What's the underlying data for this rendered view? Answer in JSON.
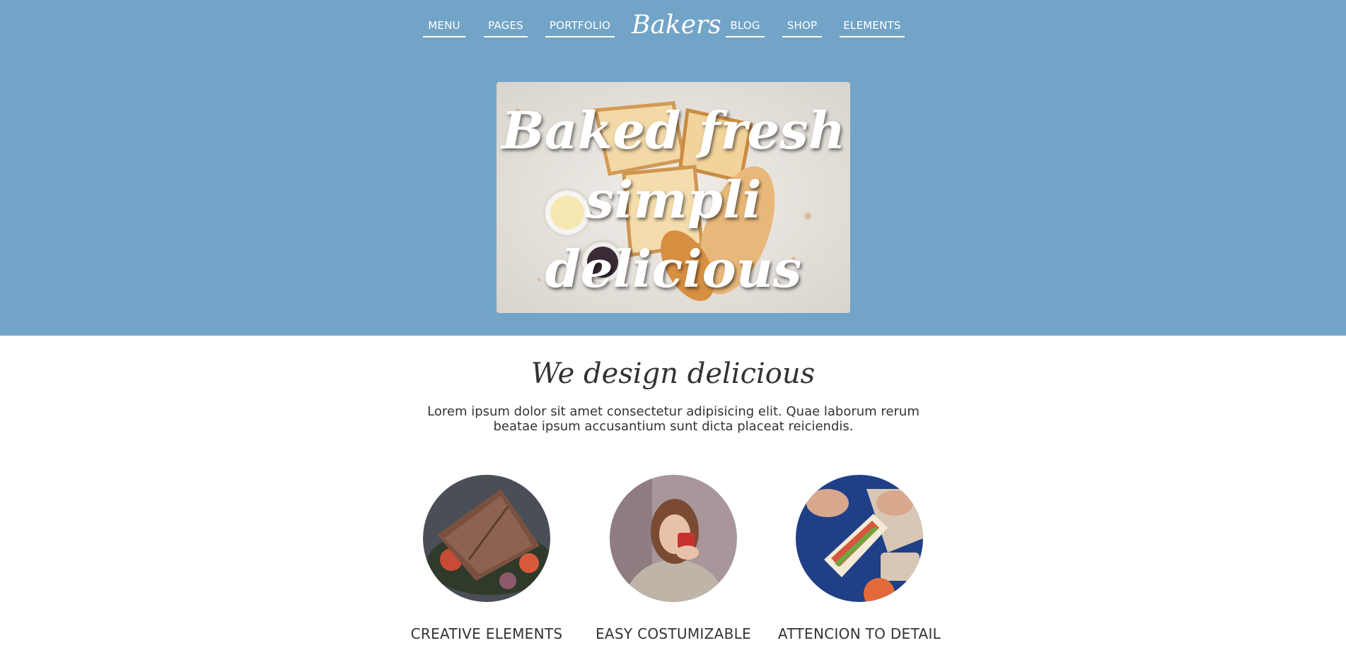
{
  "nav": {
    "items": [
      {
        "label": "MENU"
      },
      {
        "label": "PAGES"
      },
      {
        "label": "PORTFOLIO"
      },
      {
        "label": "BLOG"
      },
      {
        "label": "SHOP"
      },
      {
        "label": "ELEMENTS"
      }
    ],
    "logo": "Bakers"
  },
  "hero": {
    "headline_lines": [
      "Baked fresh",
      "simpli",
      "delicious"
    ],
    "image_icon": "bread-photo"
  },
  "intro": {
    "title": "We design delicious",
    "text": "Lorem ipsum dolor sit amet consectetur adipisicing elit. Quae laborum rerum beatae ipsum accusantium sunt dicta placeat reiciendis."
  },
  "features": [
    {
      "label": "CREATIVE ELEMENTS",
      "image_icon": "sandwich-photo"
    },
    {
      "label": "EASY COSTUMIZABLE",
      "image_icon": "woman-drinking-photo"
    },
    {
      "label": "ATTENCION TO DETAIL",
      "image_icon": "sandwich-hands-photo"
    }
  ],
  "colors": {
    "hero_background": "#72a4c7",
    "text": "#333333",
    "nav_text": "#ffffff"
  }
}
